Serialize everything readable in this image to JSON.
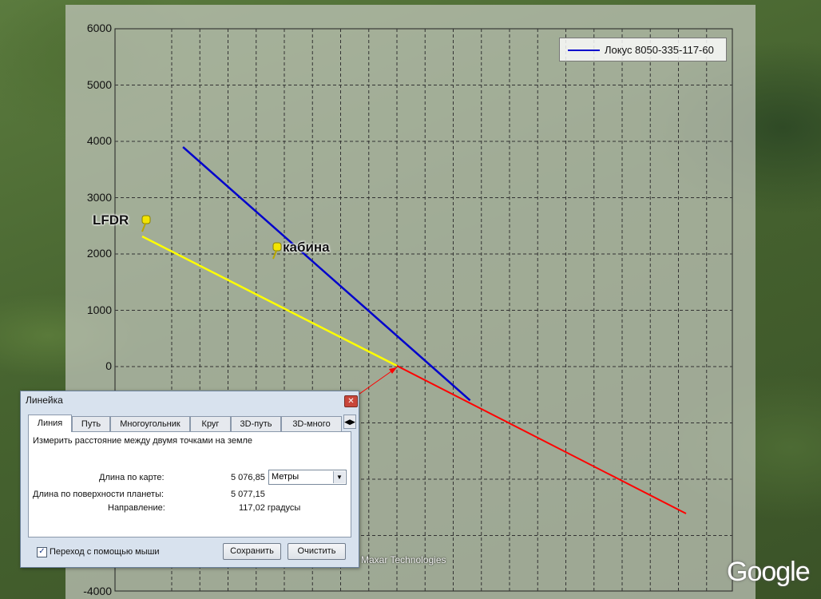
{
  "chart_data": {
    "type": "line",
    "ylim": [
      -4000,
      6000
    ],
    "yticks": [
      "6000",
      "5000",
      "4000",
      "3000",
      "2000",
      "1000",
      "0",
      "-4000"
    ],
    "grid": true,
    "legend_position": "top-right",
    "series": [
      {
        "name": "Локус 8050-335-117-60",
        "color": "#0000cc",
        "x": [
          -3800,
          1300
        ],
        "y": [
          3900,
          -600
        ]
      }
    ]
  },
  "placemarks": [
    {
      "label": "LFDR"
    },
    {
      "label": "кабина"
    }
  ],
  "colors": {
    "measure_line": "#ff0000",
    "yellow_path": "#ffff00",
    "pin": "#f2e400"
  },
  "copyright": "Maxar Technologies",
  "logo": "Google",
  "ruler": {
    "title": "Линейка",
    "tabs": [
      "Линия",
      "Путь",
      "Многоугольник",
      "Круг",
      "3D-путь",
      "3D-много"
    ],
    "description": "Измерить расстояние между двумя точками на земле",
    "map_length_label": "Длина по карте:",
    "map_length_value": "5 076,85",
    "unit": "Метры",
    "surface_length_label": "Длина по поверхности планеты:",
    "surface_length_value": "5 077,15",
    "heading_label": "Направление:",
    "heading_value": "117,02 градусы",
    "mouse_nav_label": "Переход с помощью мыши",
    "mouse_nav_checked": true,
    "save_label": "Сохранить",
    "clear_label": "Очистить"
  }
}
